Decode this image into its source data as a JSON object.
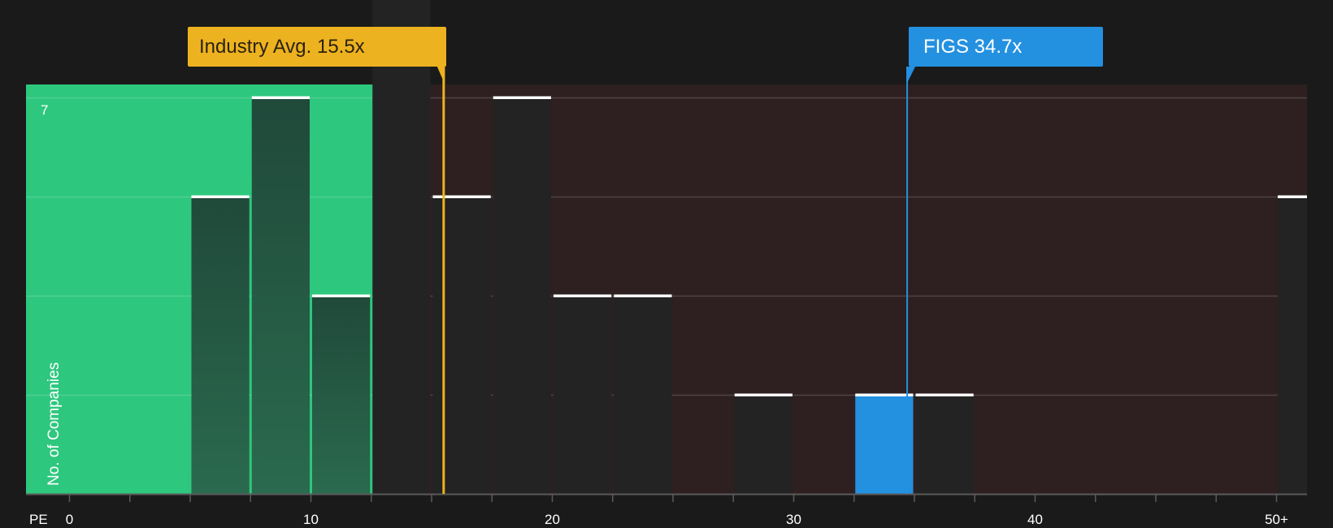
{
  "chart_data": {
    "type": "bar",
    "x_label": "PE",
    "y_label": "No. of Companies",
    "y_max_label": "7",
    "ylim": [
      0,
      7
    ],
    "xlim": [
      -2.5,
      51.25
    ],
    "bin_width": 2.5,
    "x_tick_labels": [
      {
        "value": 0,
        "label": "0"
      },
      {
        "value": 10,
        "label": "10"
      },
      {
        "value": 20,
        "label": "20"
      },
      {
        "value": 30,
        "label": "30"
      },
      {
        "value": 40,
        "label": "40"
      },
      {
        "value": 50,
        "label": "50+"
      }
    ],
    "bins": [
      {
        "start": 0,
        "count": 0
      },
      {
        "start": 2.5,
        "count": 0
      },
      {
        "start": 5,
        "count": 3
      },
      {
        "start": 7.5,
        "count": 4
      },
      {
        "start": 10,
        "count": 2
      },
      {
        "start": 12.5,
        "count": 7
      },
      {
        "start": 15,
        "count": 3
      },
      {
        "start": 17.5,
        "count": 4
      },
      {
        "start": 20,
        "count": 2
      },
      {
        "start": 22.5,
        "count": 2
      },
      {
        "start": 25,
        "count": 0
      },
      {
        "start": 27.5,
        "count": 1
      },
      {
        "start": 30,
        "count": 0
      },
      {
        "start": 32.5,
        "count": 1,
        "highlight": true
      },
      {
        "start": 35,
        "count": 1
      },
      {
        "start": 37.5,
        "count": 0
      },
      {
        "start": 40,
        "count": 0
      },
      {
        "start": 42.5,
        "count": 0
      },
      {
        "start": 45,
        "count": 0
      },
      {
        "start": 47.5,
        "count": 0
      },
      {
        "start": 50,
        "count": 3
      }
    ],
    "industry_avg": {
      "value": 15.5,
      "label": "Industry Avg. 15.5x",
      "color": "#edb21f"
    },
    "company": {
      "value": 34.7,
      "label": "FIGS 34.7x",
      "color": "#2490e0"
    },
    "undervalued_region_color": "#2ec77e",
    "overvalued_region_color": "#2e1f20",
    "bar_color": "#232323"
  }
}
